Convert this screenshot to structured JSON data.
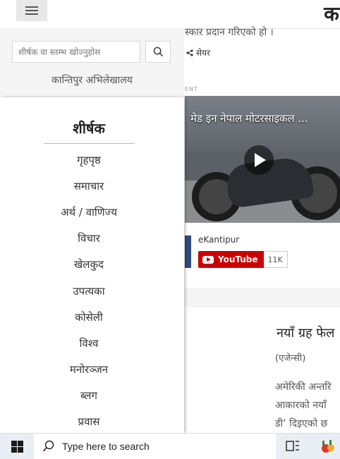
{
  "header": {
    "menu_icon": "hamburger-icon",
    "logo_text": "का"
  },
  "background_article": {
    "snippet": "स्कार प्रदान गरिएको हो ।",
    "share_label": "सेयर",
    "ad_label": "ENT",
    "video_title": "मेड इन नेपाल मोटरसाइकल ...",
    "channel_name": "eKantipur",
    "youtube_label": "YouTube",
    "subscriber_count": "11K",
    "news_title": "नयाँ ग्रह फेल",
    "news_source": "(एजेन्सी)",
    "news_body": [
      "अमेरिकी अन्तरि",
      "आकारको नयाँ",
      "डी’ दिइएको छ"
    ]
  },
  "drawer": {
    "search_placeholder": "शीर्षक वा स्तम्भ खोज्नुहोस",
    "archive_link": "कान्तिपुर अभिलेखालय",
    "heading": "शीर्षक",
    "items": [
      {
        "label": "गृहपृष्ठ"
      },
      {
        "label": "समाचार"
      },
      {
        "label": "अर्थ / वाणिज्य"
      },
      {
        "label": "विचार"
      },
      {
        "label": "खेलकुद"
      },
      {
        "label": "उपत्यका"
      },
      {
        "label": "कोसेली"
      },
      {
        "label": "विश्व"
      },
      {
        "label": "मनोरञ्जन"
      },
      {
        "label": "ब्लग"
      },
      {
        "label": "प्रवास"
      }
    ]
  },
  "taskbar": {
    "search_text": "Type here to search",
    "icons": [
      "windows-start-icon",
      "search-icon",
      "task-view-icon",
      "app-icon"
    ]
  },
  "colors": {
    "youtube_red": "#cc0000",
    "drawer_bg": "#ffffff",
    "panel_gray": "#f5f5f5",
    "taskbar_bg": "#e9eef4"
  }
}
